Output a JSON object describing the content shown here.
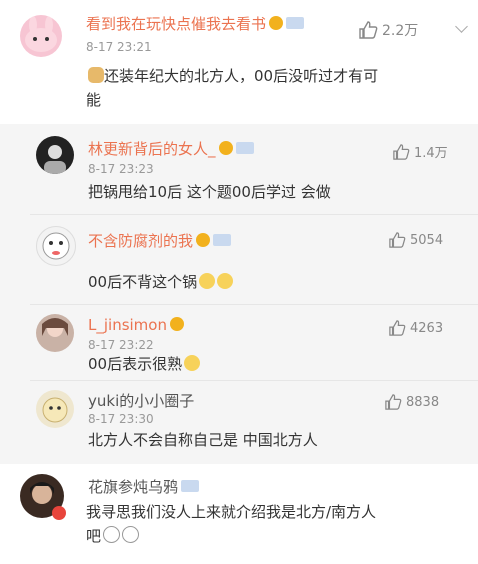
{
  "main_comment": {
    "author": "看到我在玩快点催我去看书",
    "time": "8-17 23:21",
    "likes": "2.2万",
    "text_line1": "还装年纪大的北方人，00后没听过才有可",
    "text_line2": "能"
  },
  "replies": [
    {
      "author": "林更新背后的女人_",
      "time": "8-17 23:23",
      "likes": "1.4万",
      "text": "把锅甩给10后  这个题00后学过  会做"
    },
    {
      "author": "不含防腐剂的我",
      "time": "",
      "likes": "5054",
      "text": "00后不背这个锅"
    },
    {
      "author": "L_jinsimon",
      "time": "8-17 23:22",
      "likes": "4263",
      "text": "00后表示很熟"
    },
    {
      "author": "yuki的小小圈子",
      "time": "8-17 23:30",
      "likes": "8838",
      "text": "北方人不会自称自己是 中国北方人"
    }
  ],
  "last_comment": {
    "author": "花旗参炖乌鸦",
    "text_line1": "我寻思我们没人上来就介绍我是北方/南方人",
    "text_line2": "吧"
  },
  "colors": {
    "name_orange": "#eb7350",
    "reply_bg": "#f5f5f5",
    "badge": "#c9d9ef"
  },
  "icons": [
    "thumb-up-icon",
    "chevron-down-icon",
    "vip-icon",
    "level-badge-icon",
    "emoji-icon"
  ]
}
